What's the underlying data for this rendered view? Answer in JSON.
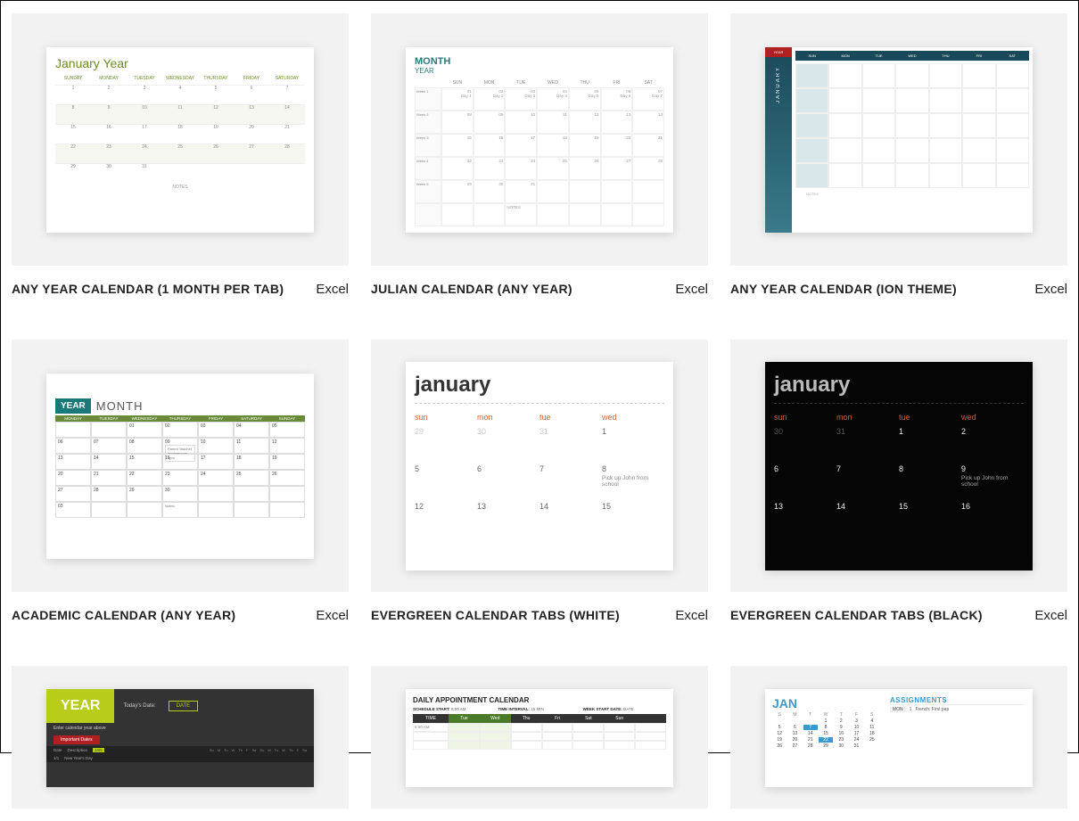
{
  "dow_full": [
    "SUNDAY",
    "MONDAY",
    "TUESDAY",
    "WEDNESDAY",
    "THURSDAY",
    "FRIDAY",
    "SATURDAY"
  ],
  "dow_short": [
    "SUN",
    "MON",
    "TUE",
    "WED",
    "THU",
    "FRI",
    "SAT"
  ],
  "dow_lower": [
    "sun",
    "mon",
    "tue",
    "wed"
  ],
  "cards": [
    {
      "title": "ANY YEAR CALENDAR (1 MONTH PER TAB)",
      "app": "Excel",
      "preview": {
        "heading": "January Year",
        "notes": "NOTES"
      }
    },
    {
      "title": "JULIAN CALENDAR (ANY YEAR)",
      "app": "Excel",
      "preview": {
        "month": "MONTH",
        "year": "YEAR",
        "notes": "NOTES"
      }
    },
    {
      "title": "ANY YEAR CALENDAR (ION THEME)",
      "app": "Excel",
      "preview": {
        "year": "YEAR",
        "month": "JANUARY",
        "notes": "NOTES"
      }
    },
    {
      "title": "ACADEMIC CALENDAR (ANY YEAR)",
      "app": "Excel",
      "preview": {
        "year": "YEAR",
        "month": "MONTH",
        "event": "Parent Teacher conferences 7pm",
        "notes_label": "Notes:"
      }
    },
    {
      "title": "EVERGREEN CALENDAR TABS (WHITE)",
      "app": "Excel",
      "preview": {
        "month": "january",
        "rows": [
          [
            "29",
            "30",
            "31",
            "1"
          ],
          [
            "5",
            "6",
            "7",
            "8"
          ],
          [
            "12",
            "13",
            "14",
            "15"
          ]
        ],
        "event": "Pick up John from school"
      }
    },
    {
      "title": "EVERGREEN CALENDAR TABS (BLACK)",
      "app": "Excel",
      "preview": {
        "month": "january",
        "rows": [
          [
            "30",
            "31",
            "1",
            "2"
          ],
          [
            "6",
            "7",
            "8",
            "9"
          ],
          [
            "13",
            "14",
            "15",
            "16"
          ]
        ],
        "event": "Pick up John from school"
      }
    },
    {
      "title": "",
      "app": "",
      "preview": {
        "year": "YEAR",
        "todays_date": "Today's Date:",
        "date_btn": "DATE",
        "enter": "Enter calendar year above",
        "important": "Important Dates",
        "col_date": "Date",
        "col_desc": "Description",
        "jan": "JAN",
        "nyd": "New Year's Day"
      }
    },
    {
      "title": "",
      "app": "",
      "preview": {
        "heading": "DAILY APPOINTMENT CALENDAR",
        "schedule_start_label": "SCHEDULE START:",
        "schedule_start": "8:00 AM",
        "interval_label": "TIME INTERVAL:",
        "interval": "15 MIN",
        "week_start_label": "WEEK START DATE:",
        "week_start": "DATE",
        "time_col": "TIME",
        "days": [
          "Tue",
          "Wed",
          "Thu",
          "Fri",
          "Sat",
          "Sun"
        ],
        "first_time": "8:00 AM"
      }
    },
    {
      "title": "",
      "app": "",
      "preview": {
        "month": "JAN",
        "dow": [
          "S",
          "M",
          "T",
          "W",
          "T",
          "F",
          "S"
        ],
        "weeks": [
          [
            "",
            "",
            "",
            "1",
            "2",
            "3",
            "4"
          ],
          [
            "5",
            "6",
            "7",
            "8",
            "9",
            "10",
            "11"
          ],
          [
            "12",
            "13",
            "14",
            "15",
            "16",
            "17",
            "18"
          ],
          [
            "19",
            "20",
            "21",
            "22",
            "23",
            "24",
            "25"
          ],
          [
            "26",
            "27",
            "28",
            "29",
            "30",
            "31",
            ""
          ]
        ],
        "highlight": [
          "7",
          "22"
        ],
        "assignments_heading": "ASSIGNMENTS",
        "assign_day": "MON",
        "assign_num": "1",
        "assign_text": "French: First pap"
      }
    }
  ]
}
